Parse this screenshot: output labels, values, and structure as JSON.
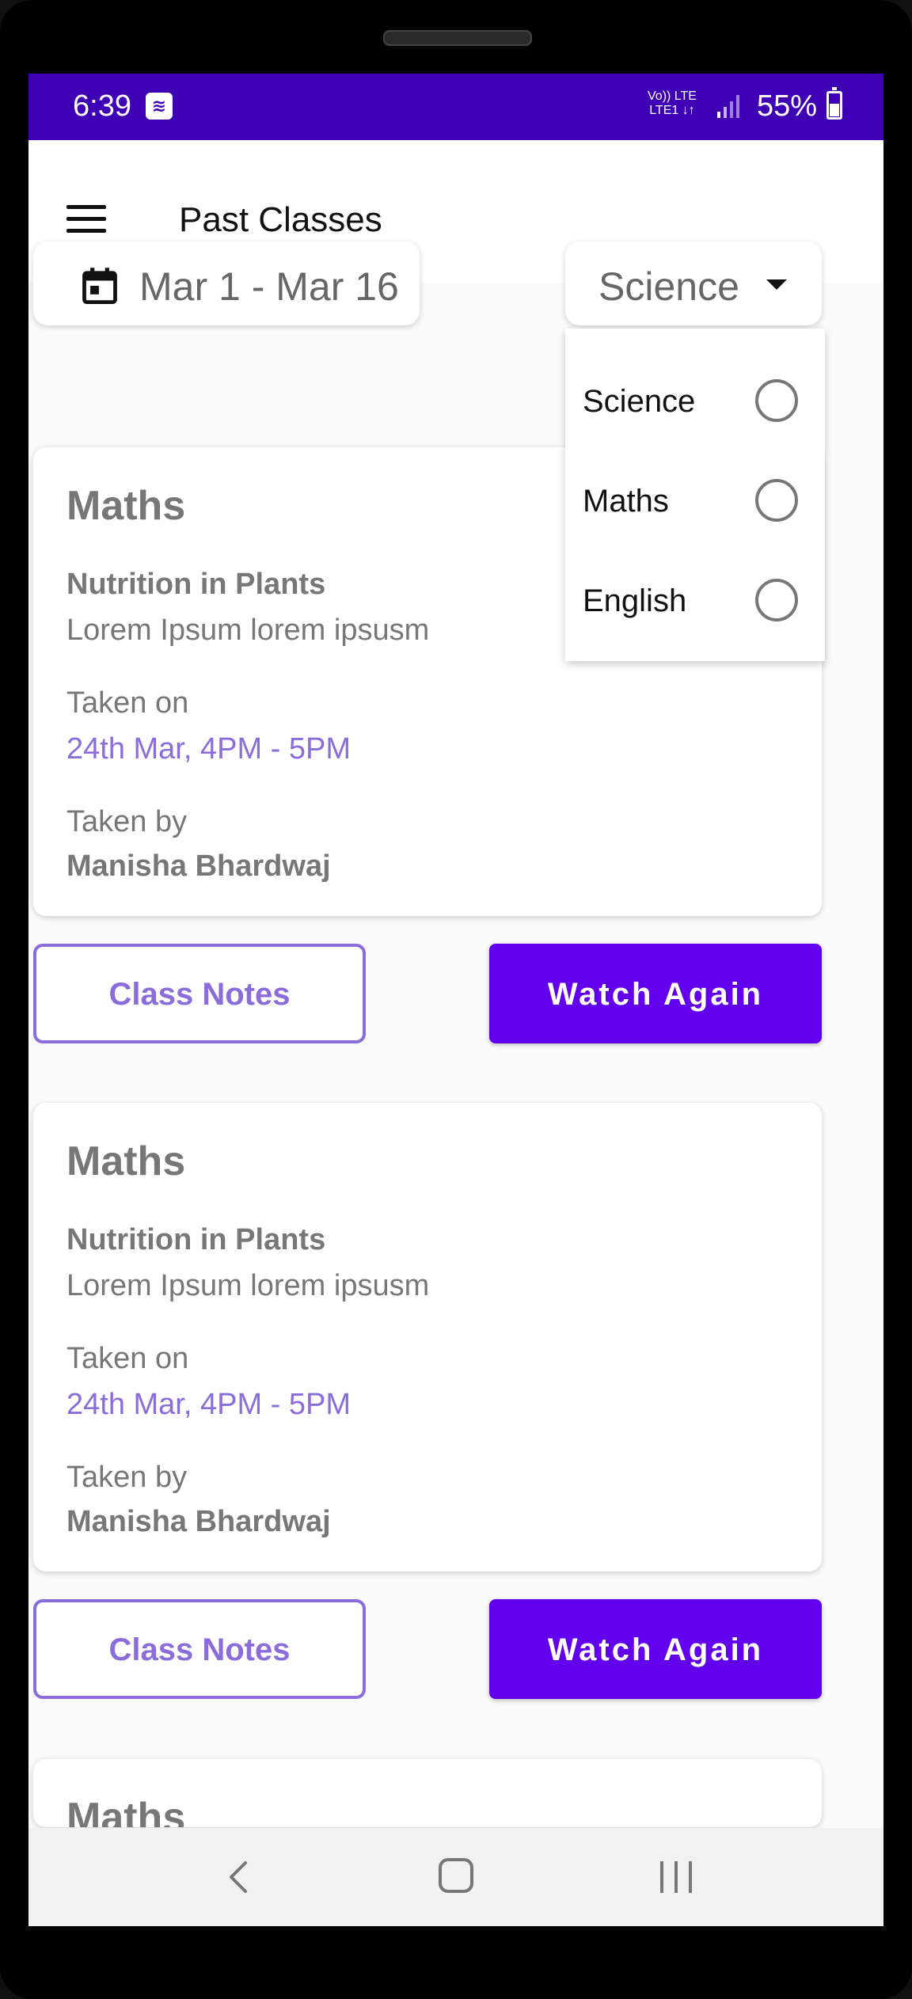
{
  "status_bar": {
    "time": "6:39",
    "network_top": "Vo)) LTE",
    "network_bottom": "LTE1 ↓↑",
    "battery": "55%"
  },
  "app_bar": {
    "title": "Past Classes"
  },
  "filters": {
    "date_range": "Mar 1 - Mar 16",
    "subject_selected": "Science",
    "subject_options": [
      "Science",
      "Maths",
      "English"
    ]
  },
  "cards": [
    {
      "subject": "Maths",
      "topic": "Nutrition in Plants",
      "description": "Lorem Ipsum lorem ipsusm",
      "taken_on_label": "Taken on",
      "taken_on": "24th Mar, 4PM - 5PM",
      "taken_by_label": "Taken by",
      "taken_by": "Manisha Bhardwaj",
      "notes_label": "Class Notes",
      "watch_label": "Watch Again"
    },
    {
      "subject": "Maths",
      "topic": "Nutrition in Plants",
      "description": "Lorem Ipsum lorem ipsusm",
      "taken_on_label": "Taken on",
      "taken_on": "24th Mar, 4PM - 5PM",
      "taken_by_label": "Taken by",
      "taken_by": "Manisha Bhardwaj",
      "notes_label": "Class Notes",
      "watch_label": "Watch Again"
    },
    {
      "subject": "Maths"
    }
  ],
  "colors": {
    "status_bar": "#3f00b5",
    "primary": "#6200ee",
    "accent_text": "#8a6ddb"
  }
}
